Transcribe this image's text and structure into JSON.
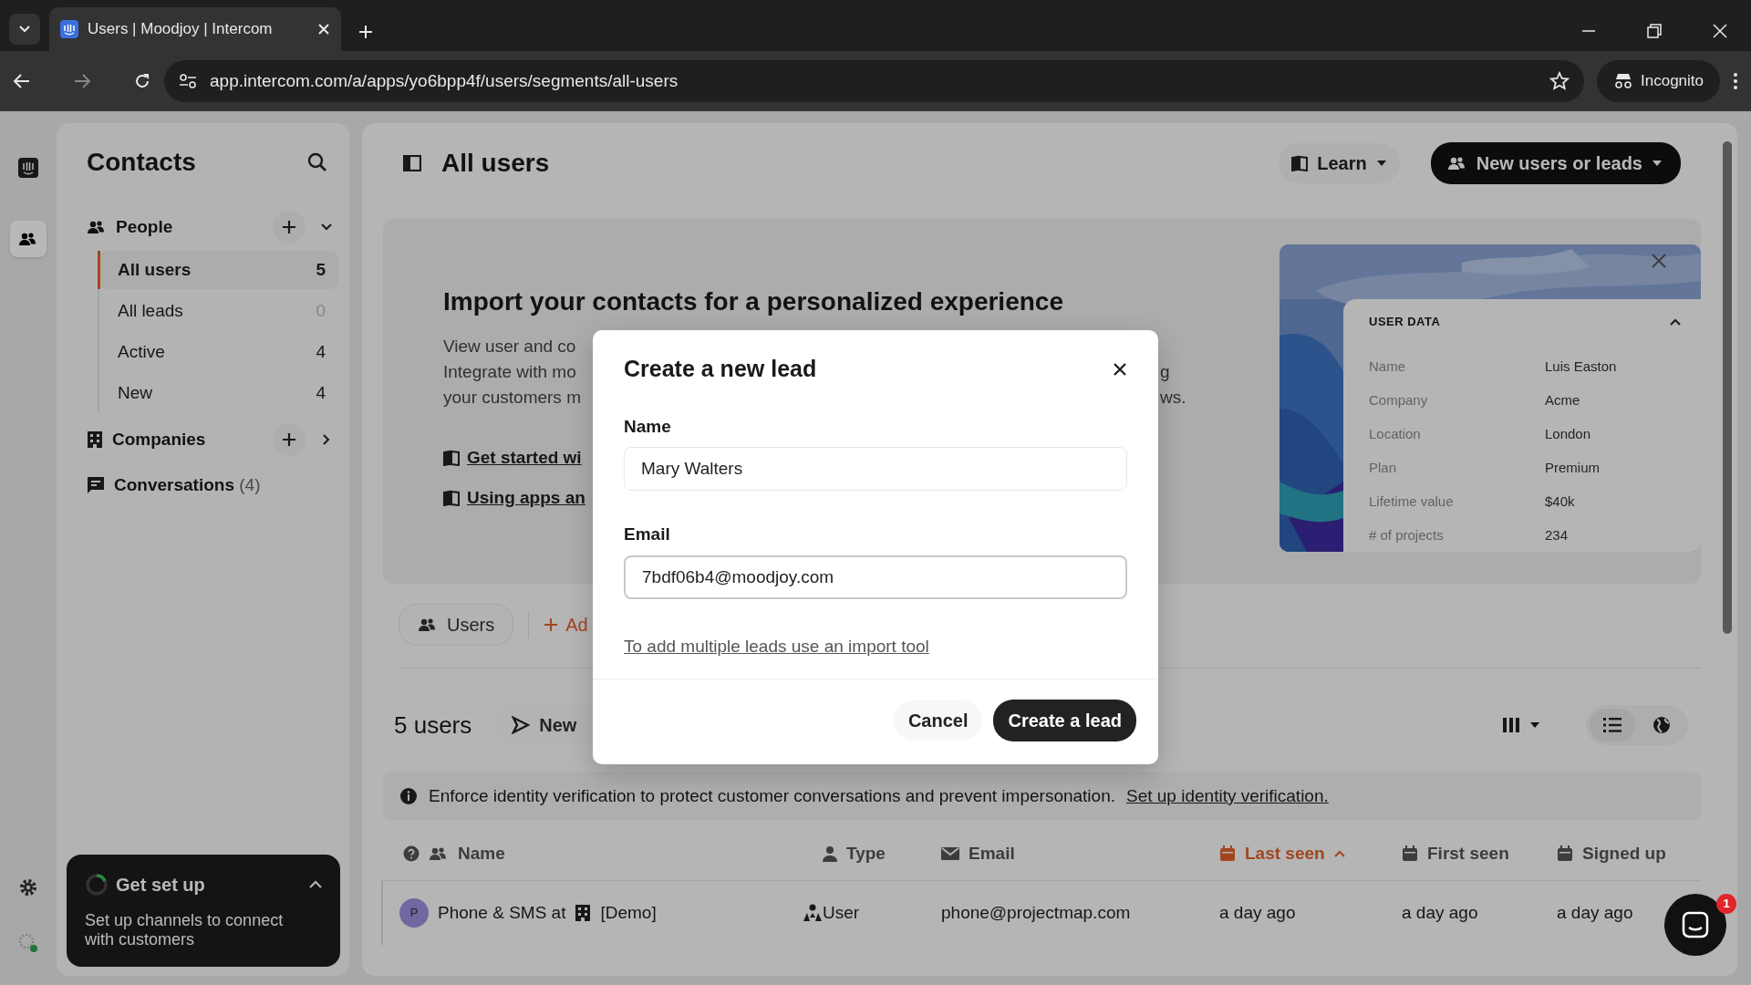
{
  "browser": {
    "tabs": [
      {
        "title": "Users | Moodjoy | Intercom",
        "selected": true
      }
    ],
    "url": "app.intercom.com/a/apps/yo6bpp4f/users/segments/all-users",
    "profile": "Incognito"
  },
  "rail": {
    "items": [
      {
        "kind": "logo",
        "selected": false
      },
      {
        "kind": "contacts",
        "selected": true
      }
    ]
  },
  "sidebar": {
    "title": "Contacts",
    "sections": [
      {
        "kind": "people",
        "label": "People",
        "expanded": true,
        "items": [
          {
            "label": "All users",
            "count": "5",
            "selected": true,
            "muted": false
          },
          {
            "label": "All leads",
            "count": "0",
            "selected": false,
            "muted": true
          },
          {
            "label": "Active",
            "count": "4",
            "selected": false,
            "muted": false
          },
          {
            "label": "New",
            "count": "4",
            "selected": false,
            "muted": false
          }
        ]
      },
      {
        "kind": "companies",
        "label": "Companies",
        "expanded": false
      },
      {
        "kind": "conversations",
        "label": "Conversations",
        "count": "(4)"
      }
    ],
    "setup": {
      "title": "Get set up",
      "text": "Set up channels to connect with customers",
      "expanded": true
    }
  },
  "header": {
    "title": "All users",
    "learn": "Learn",
    "primary": "New users or leads"
  },
  "intro": {
    "title": "Import your contacts for a personalized experience",
    "lines": [
      {
        "left": "View user and co"
      },
      {
        "left": "Integrate with mo",
        "right": "g"
      },
      {
        "left": "your customers m",
        "right": "ws."
      }
    ],
    "links": [
      "Get started wi",
      "Using apps an"
    ],
    "user_data": {
      "title": "USER DATA",
      "expanded": true,
      "rows": [
        {
          "label": "Name",
          "value": "Luis Easton"
        },
        {
          "label": "Company",
          "value": "Acme"
        },
        {
          "label": "Location",
          "value": "London"
        },
        {
          "label": "Plan",
          "value": "Premium"
        },
        {
          "label": "Lifetime value",
          "value": "$40k"
        },
        {
          "label": "# of projects",
          "value": "234"
        }
      ]
    }
  },
  "segment_tab": "Users",
  "add_button": "Ad",
  "count_title": "5 users",
  "new_button": "New",
  "banner": {
    "text": "Enforce identity verification to protect customer conversations and prevent impersonation.",
    "link": "Set up identity verification."
  },
  "table": {
    "columns": [
      {
        "kind": "name",
        "label": "Name",
        "sorted": false
      },
      {
        "kind": "type",
        "label": "Type",
        "sorted": false
      },
      {
        "kind": "email",
        "label": "Email",
        "sorted": false
      },
      {
        "kind": "date",
        "label": "Last seen",
        "sorted": true
      },
      {
        "kind": "date",
        "label": "First seen",
        "sorted": false
      },
      {
        "kind": "date",
        "label": "Signed up",
        "sorted": false
      }
    ],
    "rows": [
      {
        "avatar": "P",
        "color": "#7167a1",
        "name": "Phone & SMS at",
        "company": "[Demo]",
        "type": "User",
        "email": "phone@projectmap.com",
        "last_seen": "a day ago",
        "first_seen": "a day ago",
        "signed_up": "a day ago"
      }
    ]
  },
  "modal": {
    "title": "Create a new lead",
    "fields": [
      {
        "label": "Name",
        "value": "Mary Walters",
        "focused": false
      },
      {
        "label": "Email",
        "value": "7bdf06b4@moodjoy.com",
        "focused": true
      }
    ],
    "link": "To add multiple leads use an import tool",
    "cancel": "Cancel",
    "submit": "Create a lead"
  },
  "messenger": {
    "badge": "1"
  }
}
